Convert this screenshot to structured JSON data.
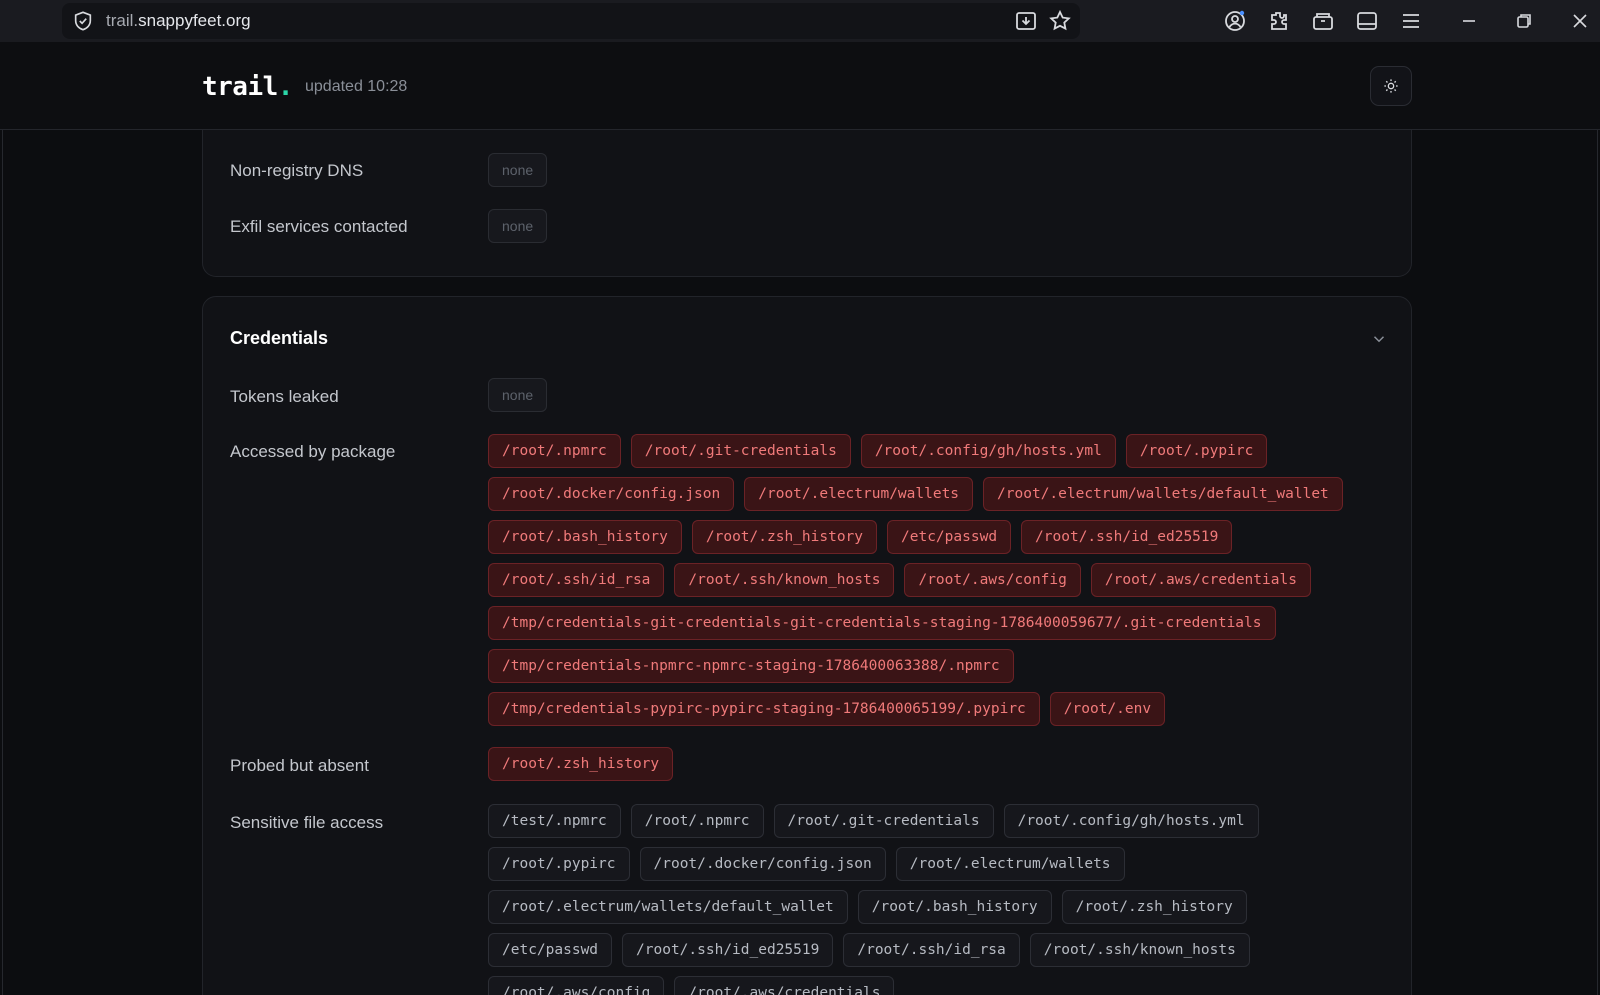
{
  "browser": {
    "url_prefix": "trail.",
    "url_host": "snappyfeet.org",
    "icons": [
      "shield-icon",
      "download-icon",
      "star-icon",
      "account-icon",
      "extensions-icon",
      "container-icon",
      "sidebar-icon",
      "menu-icon",
      "minimize-icon",
      "restore-icon",
      "close-icon"
    ]
  },
  "header": {
    "logo_text": "trail",
    "logo_dot": ".",
    "updated": "updated 10:28",
    "theme_icon": "sun-icon"
  },
  "network": {
    "rows": [
      {
        "label": "Non-registry DNS",
        "value": "none"
      },
      {
        "label": "Exfil services contacted",
        "value": "none"
      }
    ]
  },
  "credentials": {
    "title": "Credentials",
    "tokens_leaked": {
      "label": "Tokens leaked",
      "value": "none"
    },
    "accessed_by_package": {
      "label": "Accessed by package",
      "items": [
        "/root/.npmrc",
        "/root/.git-credentials",
        "/root/.config/gh/hosts.yml",
        "/root/.pypirc",
        "/root/.docker/config.json",
        "/root/.electrum/wallets",
        "/root/.electrum/wallets/default_wallet",
        "/root/.bash_history",
        "/root/.zsh_history",
        "/etc/passwd",
        "/root/.ssh/id_ed25519",
        "/root/.ssh/id_rsa",
        "/root/.ssh/known_hosts",
        "/root/.aws/config",
        "/root/.aws/credentials",
        "/tmp/credentials-git-credentials-git-credentials-staging-1786400059677/.git-credentials",
        "/tmp/credentials-npmrc-npmrc-staging-1786400063388/.npmrc",
        "/tmp/credentials-pypirc-pypirc-staging-1786400065199/.pypirc",
        "/root/.env"
      ]
    },
    "probed_but_absent": {
      "label": "Probed but absent",
      "items": [
        "/root/.zsh_history"
      ]
    },
    "sensitive_file_access": {
      "label": "Sensitive file access",
      "items": [
        "/test/.npmrc",
        "/root/.npmrc",
        "/root/.git-credentials",
        "/root/.config/gh/hosts.yml",
        "/root/.pypirc",
        "/root/.docker/config.json",
        "/root/.electrum/wallets",
        "/root/.electrum/wallets/default_wallet",
        "/root/.bash_history",
        "/root/.zsh_history",
        "/etc/passwd",
        "/root/.ssh/id_ed25519",
        "/root/.ssh/id_rsa",
        "/root/.ssh/known_hosts",
        "/root/.aws/config",
        "/root/.aws/credentials"
      ]
    }
  }
}
